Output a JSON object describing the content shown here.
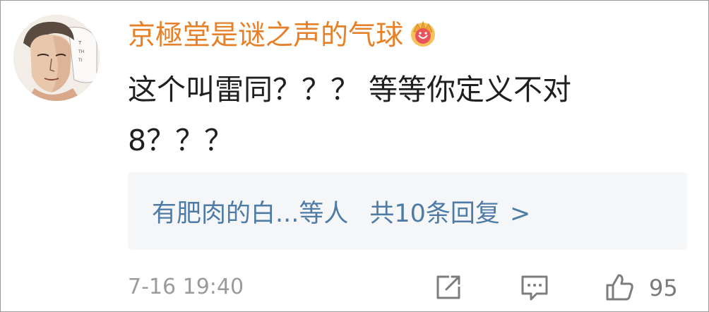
{
  "comment": {
    "username": "京極堂是谜之声的气球",
    "badge_icon": "crown-icon",
    "text": "这个叫雷同？？？ 等等你定义不对8？？？",
    "replies": {
      "names": "有肥肉的白...等人",
      "count_text": "共10条回复",
      "chevron": ">"
    },
    "timestamp": "7-16 19:40",
    "actions": {
      "share_icon": "share-icon",
      "reply_icon": "comment-icon",
      "like_icon": "thumbs-up-icon",
      "like_count": "95"
    }
  },
  "colors": {
    "username": "#e6812a",
    "reply_link": "#4f7ca6",
    "reply_bg": "#f4f6f8",
    "muted": "#9b9b9b"
  }
}
